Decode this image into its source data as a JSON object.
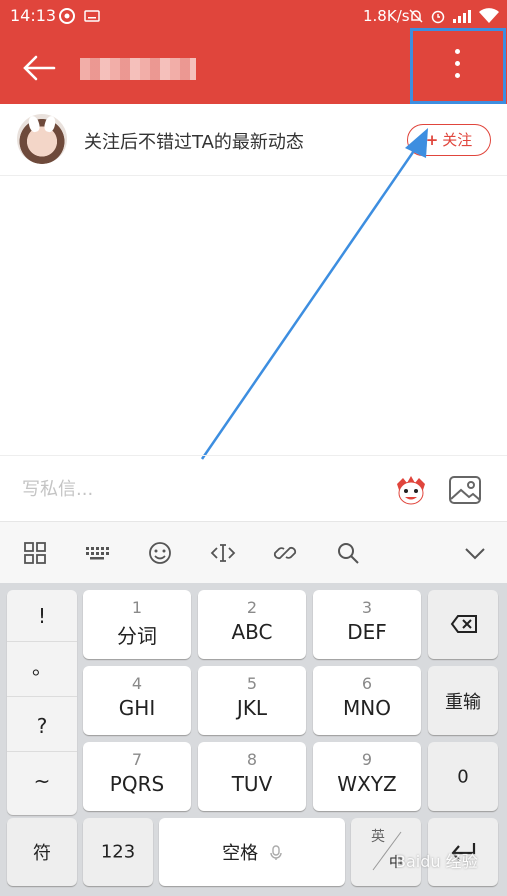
{
  "status": {
    "time": "14:13",
    "speed": "1.8K/s"
  },
  "follow": {
    "text": "关注后不错过TA的最新动态",
    "button": "关注"
  },
  "message": {
    "placeholder": "写私信..."
  },
  "keyboard": {
    "side_keys": [
      "!",
      "。",
      "?",
      "~"
    ],
    "rows": [
      [
        {
          "num": "1",
          "label": "分词"
        },
        {
          "num": "2",
          "label": "ABC"
        },
        {
          "num": "3",
          "label": "DEF"
        }
      ],
      [
        {
          "num": "4",
          "label": "GHI"
        },
        {
          "num": "5",
          "label": "JKL"
        },
        {
          "num": "6",
          "label": "MNO"
        }
      ],
      [
        {
          "num": "7",
          "label": "PQRS"
        },
        {
          "num": "8",
          "label": "TUV"
        },
        {
          "num": "9",
          "label": "WXYZ"
        }
      ]
    ],
    "right_keys": {
      "reenter": "重输",
      "zero": "0"
    },
    "bottom": {
      "symbol": "符",
      "num_mode": "123",
      "space": "空格",
      "lang_top": "英",
      "lang_bottom": "中"
    }
  },
  "colors": {
    "brand": "#e0453c",
    "highlight": "#3d8ee0"
  },
  "watermark": "Baidu 经验"
}
